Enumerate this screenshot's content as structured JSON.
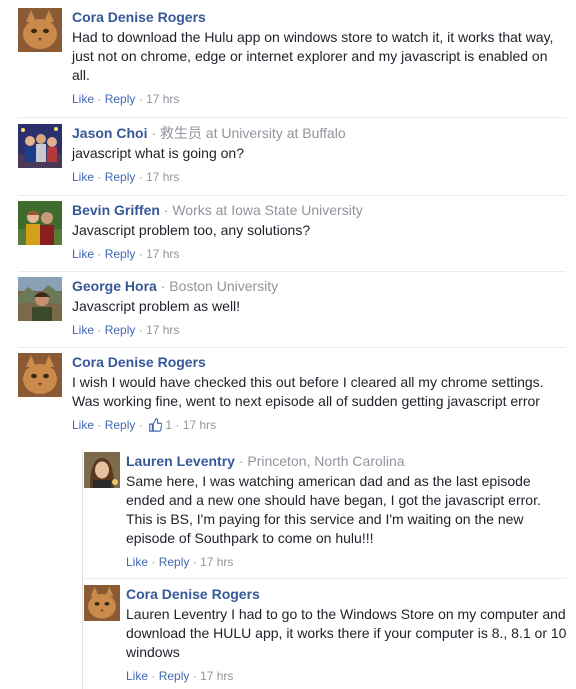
{
  "comments": [
    {
      "name": "Cora Denise Rogers",
      "meta": "",
      "text": "Had to download the Hulu app on windows store to watch it, it works that way, just not on chrome, edge or internet explorer and my javascript is enabled on all.",
      "like": "Like",
      "sep": "·",
      "reply": "Reply",
      "time": "17 hrs",
      "avatar": "cat-avatar"
    },
    {
      "name": "Jason Choi",
      "meta": " · 救生员 at University at Buffalo",
      "text": "javascript what is going on?",
      "like": "Like",
      "sep": "·",
      "reply": "Reply",
      "time": "17 hrs",
      "avatar": "group-photo-avatar"
    },
    {
      "name": "Bevin Griffen",
      "meta": " · Works at Iowa State University",
      "text": "Javascript problem too, any solutions?",
      "like": "Like",
      "sep": "·",
      "reply": "Reply",
      "time": "17 hrs",
      "avatar": "couple-photo-avatar"
    },
    {
      "name": "George Hora",
      "meta": " · Boston University",
      "text": "Javascript problem as well!",
      "like": "Like",
      "sep": "·",
      "reply": "Reply",
      "time": "17 hrs",
      "avatar": "outdoor-photo-avatar"
    },
    {
      "name": "Cora Denise Rogers",
      "meta": "",
      "text": "I wish I would have checked this out before I cleared all my chrome settings. Was working fine, went to next episode all of sudden getting javascript error",
      "like": "Like",
      "sep": "·",
      "reply": "Reply",
      "like_count": "1",
      "time": "17 hrs",
      "avatar": "cat-avatar"
    }
  ],
  "replies": [
    {
      "name": "Lauren Leventry",
      "meta": " · Princeton, North Carolina",
      "text": "Same here, I was watching american dad and as the last episode ended and a new one should have began, I got the javascript error. This is BS, I'm paying for this service and I'm waiting on the new episode of Southpark to come on hulu!!!",
      "like": "Like",
      "sep": "·",
      "reply": "Reply",
      "time": "17 hrs",
      "avatar": "woman-portrait-avatar"
    },
    {
      "name": "Cora Denise Rogers",
      "meta": "",
      "text": "Lauren Leventry I had to go to the Windows Store on my computer and download the HULU app, it works there if your computer is 8., 8.1 or 10 windows",
      "like": "Like",
      "sep": "·",
      "reply": "Reply",
      "time": "17 hrs",
      "avatar": "cat-avatar"
    }
  ]
}
